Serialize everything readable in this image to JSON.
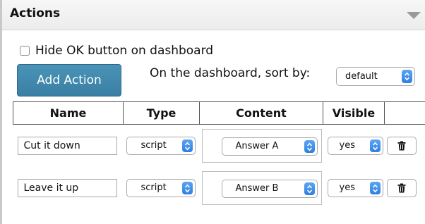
{
  "panel": {
    "title": "Actions",
    "collapse_icon": "triangle-down-icon"
  },
  "options": {
    "hide_ok_label": "Hide OK button on dashboard",
    "hide_ok_checked": false,
    "add_action_label": "Add Action",
    "sort_label": "On the dashboard, sort by:",
    "sort_value": "default"
  },
  "table": {
    "headers": [
      "Name",
      "Type",
      "Content",
      "Visible",
      ""
    ],
    "rows": [
      {
        "name": "Cut it down",
        "type": "script",
        "content": "Answer A",
        "visible": "yes",
        "delete_icon": "trash-icon"
      },
      {
        "name": "Leave it up",
        "type": "script",
        "content": "Answer B",
        "visible": "yes",
        "delete_icon": "trash-icon"
      }
    ]
  },
  "colors": {
    "add_button": "#3f86ab",
    "stepper": "#3b87e6"
  }
}
